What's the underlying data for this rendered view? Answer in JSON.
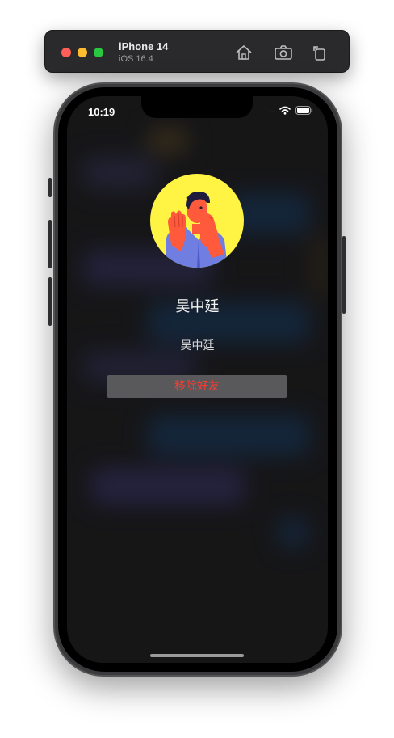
{
  "simulator": {
    "device_name": "iPhone 14",
    "os_version": "iOS 16.4",
    "buttons": [
      "home-icon",
      "screenshot-icon",
      "rotate-icon"
    ],
    "traffic_lights": {
      "close": "#ff5f57",
      "minimize": "#febc2e",
      "zoom": "#28c840"
    }
  },
  "status_bar": {
    "time": "10:19",
    "signal": "....",
    "icons": [
      "wifi-icon",
      "battery-icon"
    ]
  },
  "profile": {
    "nickname": "吴中廷",
    "username": "吴中廷",
    "avatar": "person-waving-avatar",
    "avatar_bg": "#fff343"
  },
  "actions": {
    "remove_friend_label": "移除好友",
    "remove_friend_color": "#ff3b30"
  }
}
